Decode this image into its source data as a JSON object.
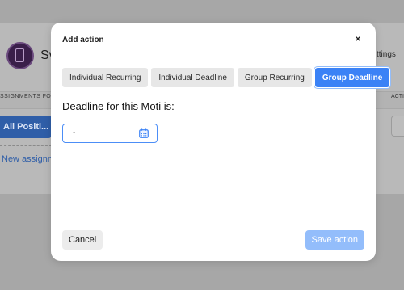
{
  "background": {
    "title": "Sv",
    "settings_text": "ttings",
    "col_left": "SSIGNMENTS FOR",
    "col_right": "ACTI",
    "positions_label": "All Positi...",
    "new_assignment": "New assignm"
  },
  "modal": {
    "title": "Add action",
    "close_glyph": "×",
    "tabs": [
      {
        "label": "Individual Recurring"
      },
      {
        "label": "Individual Deadline"
      },
      {
        "label": "Group Recurring"
      },
      {
        "label": "Group Deadline",
        "active": true
      }
    ],
    "deadline_label": "Deadline for this Moti is:",
    "date_value": "-",
    "cancel_label": "Cancel",
    "save_label": "Save action"
  },
  "colors": {
    "accent": "#3b82f6",
    "save_disabled": "#93bdfb",
    "overlay": "#808080"
  }
}
